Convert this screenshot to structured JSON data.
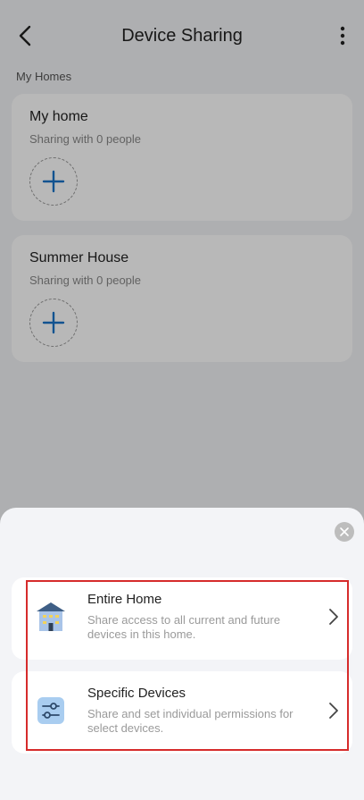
{
  "header": {
    "title": "Device Sharing"
  },
  "homes": {
    "section_label": "My Homes",
    "items": [
      {
        "name": "My home",
        "sharing": "Sharing with 0 people"
      },
      {
        "name": "Summer House",
        "sharing": "Sharing with 0 people"
      }
    ]
  },
  "sheet": {
    "options": [
      {
        "title": "Entire Home",
        "description": "Share access to all current and future devices in this home.",
        "icon": "house-icon"
      },
      {
        "title": "Specific Devices",
        "description": "Share and set individual permissions for select devices.",
        "icon": "sliders-icon"
      }
    ]
  },
  "colors": {
    "accent": "#1a73c8",
    "highlight": "#d62b2b"
  }
}
